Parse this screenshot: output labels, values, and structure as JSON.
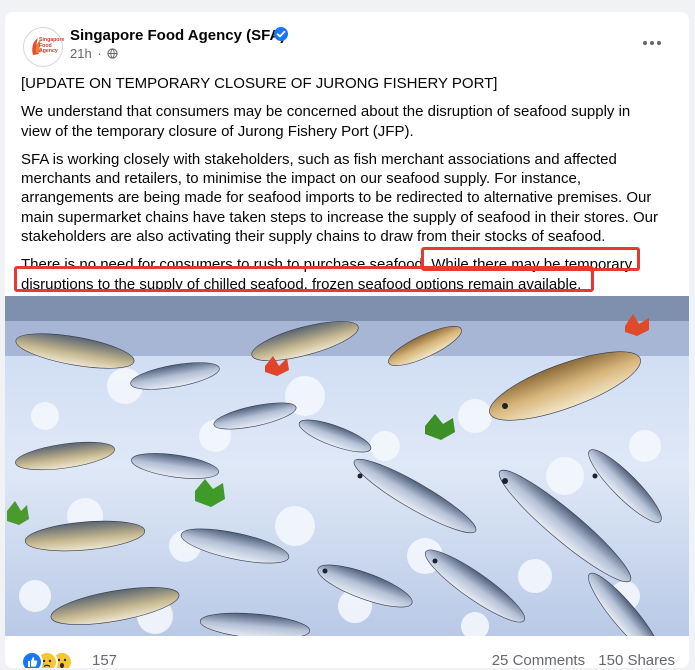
{
  "post": {
    "page_name": "Singapore Food Agency (SFA)",
    "logo_text_line1": "Singapore",
    "logo_text_line2": "Food",
    "logo_text_line3": "Agency",
    "timestamp": "21h",
    "separator": "·",
    "paragraphs": {
      "p1": "[UPDATE ON TEMPORARY CLOSURE OF JURONG FISHERY PORT]",
      "p2": "We understand that consumers may be concerned about the disruption of seafood supply in view of the temporary closure of Jurong Fishery Port (JFP).",
      "p3": "SFA is working closely with stakeholders, such as fish merchant associations and affected merchants and retailers, to minimise the impact on our seafood supply. For instance, arrangements are being made for seafood imports to be redirected to alternative premises.  Our main supermarket chains have taken steps to increase the supply of seafood in their stores. Our stakeholders are also activating their supply chains to draw from their stocks of seafood.",
      "p4_start": "There is no need for consumers to rush to purchase seafood.",
      "p4_highlight": " While there may be temporary disruptions to the supply of chilled seafood, frozen seafood options remain available."
    }
  },
  "footer": {
    "reaction_count": "157",
    "comments": "25 Comments",
    "shares": "150 Shares"
  },
  "icons": {
    "verified": "verified-badge-icon",
    "audience": "globe-icon",
    "more": "more-options-icon",
    "reactions": [
      "like-reaction-icon",
      "sad-reaction-icon",
      "wow-reaction-icon"
    ]
  },
  "colors": {
    "facebook_blue": "#1877f2",
    "highlight_red": "#e53935",
    "text_secondary": "#65676b"
  }
}
